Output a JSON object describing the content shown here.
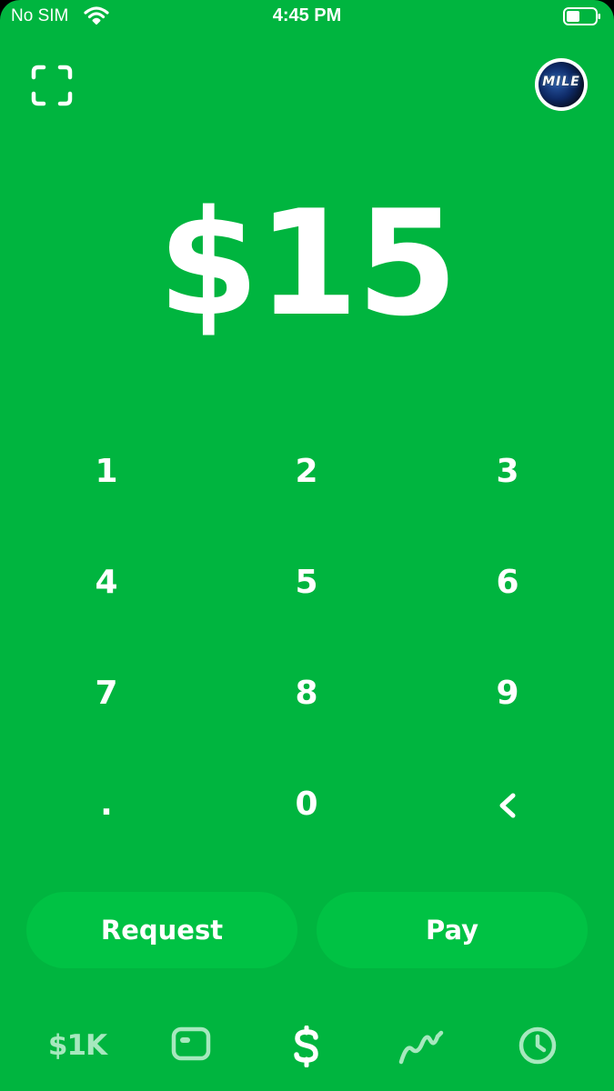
{
  "status_bar": {
    "carrier": "No SIM",
    "time": "4:45 PM"
  },
  "header": {
    "scan_icon": "qr-scan-icon",
    "avatar_text": "MILE"
  },
  "amount": "$15",
  "keypad": {
    "keys": [
      "1",
      "2",
      "3",
      "4",
      "5",
      "6",
      "7",
      "8",
      "9",
      ".",
      "0"
    ],
    "backspace_icon": "chevron-left-icon"
  },
  "actions": {
    "request_label": "Request",
    "pay_label": "Pay"
  },
  "tab_bar": {
    "balance_label": "$1K",
    "card_icon": "card-icon",
    "pay_icon": "dollar-icon",
    "investing_icon": "stock-line-icon",
    "activity_icon": "clock-icon"
  },
  "colors": {
    "background": "#00b53f",
    "button": "#00c244",
    "inactive_tab": "#a6e8be",
    "text": "#ffffff"
  }
}
